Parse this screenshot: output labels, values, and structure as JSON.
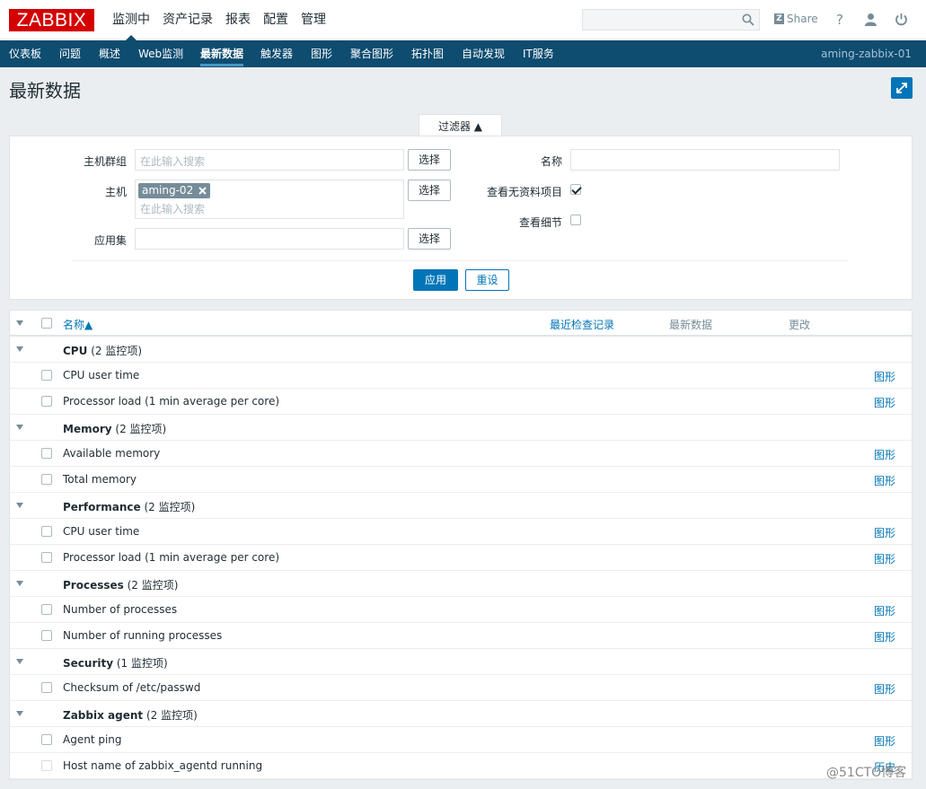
{
  "header": {
    "logo": "ZABBIX",
    "menu": [
      "监测中",
      "资产记录",
      "报表",
      "配置",
      "管理"
    ],
    "share": "Share",
    "help": "?"
  },
  "subnav": {
    "items": [
      "仪表板",
      "问题",
      "概述",
      "Web监测",
      "最新数据",
      "触发器",
      "图形",
      "聚合图形",
      "拓扑图",
      "自动发现",
      "IT服务"
    ],
    "server": "aming-zabbix-01"
  },
  "page": {
    "title": "最新数据"
  },
  "filter": {
    "tab": "过滤器 ▲",
    "host_group_label": "主机群组",
    "host_group_placeholder": "在此输入搜索",
    "host_label": "主机",
    "host_tag": "aming-02",
    "host_placeholder": "在此输入搜索",
    "app_label": "应用集",
    "select_btn": "选择",
    "name_label": "名称",
    "show_no_data_label": "查看无资料项目",
    "show_no_data": true,
    "show_details_label": "查看细节",
    "show_details": false,
    "apply": "应用",
    "reset": "重设"
  },
  "table": {
    "headers": {
      "name": "名称▲",
      "last_check": "最近检查记录",
      "last_value": "最新数据",
      "change": "更改"
    },
    "graph_link": "图形",
    "groups": [
      {
        "name": "CPU",
        "count": "(2 监控项)",
        "items": [
          "CPU user time",
          "Processor load (1 min average per core)"
        ]
      },
      {
        "name": "Memory",
        "count": "(2 监控项)",
        "items": [
          "Available memory",
          "Total memory"
        ]
      },
      {
        "name": "Performance",
        "count": "(2 监控项)",
        "items": [
          "CPU user time",
          "Processor load (1 min average per core)"
        ]
      },
      {
        "name": "Processes",
        "count": "(2 监控项)",
        "items": [
          "Number of processes",
          "Number of running processes"
        ]
      },
      {
        "name": "Security",
        "count": "(1 监控项)",
        "items": [
          "Checksum of /etc/passwd"
        ]
      },
      {
        "name": "Zabbix agent",
        "count": "(2 监控项)",
        "items": [
          "Agent ping",
          "Host name of zabbix_agentd running"
        ]
      }
    ],
    "last_row_link": "历史"
  },
  "watermark": "@51CTO博客"
}
